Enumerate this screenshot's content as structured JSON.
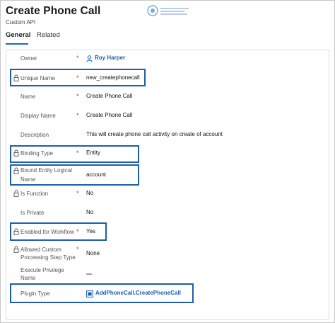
{
  "header": {
    "title": "Create Phone Call",
    "subtitle": "Custom API"
  },
  "tabs": [
    {
      "label": "General"
    },
    {
      "label": "Related"
    }
  ],
  "fields": [
    {
      "label": "Owner",
      "value": "Roy Harper",
      "required": "*"
    },
    {
      "label": "Unique Name",
      "value": "new_createphonecall",
      "required": "*"
    },
    {
      "label": "Name",
      "value": "Create Phone Call",
      "required": "*"
    },
    {
      "label": "Display Name",
      "value": "Create Phone Call",
      "required": "*"
    },
    {
      "label": "Description",
      "value": "This will create phone call activity on create of account"
    },
    {
      "label": "Binding Type",
      "value": "Entity",
      "required": "*"
    },
    {
      "label": "Bound Entity Logical",
      "label2": "Name",
      "value": "account"
    },
    {
      "label": "Is Function",
      "value": "No",
      "required": "*"
    },
    {
      "label": "Is Private",
      "value": "No"
    },
    {
      "label": "Enabled for Workflow",
      "value": "Yes",
      "required": "*"
    },
    {
      "label": "Allowed Custom",
      "label2": "Processing Step Type",
      "value": "None",
      "required": "*"
    },
    {
      "label": "Execute Privilege",
      "label2": "Name",
      "value": "---"
    },
    {
      "label": "Plugin Type",
      "value": "AddPhoneCall.CreatePhoneCall"
    }
  ],
  "icons": {
    "owner": "person-icon",
    "plugin": "plugin-type-icon",
    "lock": "lock-icon",
    "brand": "logo-icon"
  },
  "colors": {
    "accent": "#2266cc",
    "highlight": "#1e5ea8",
    "required": "#c0392b",
    "link": "#1a5fb4"
  }
}
